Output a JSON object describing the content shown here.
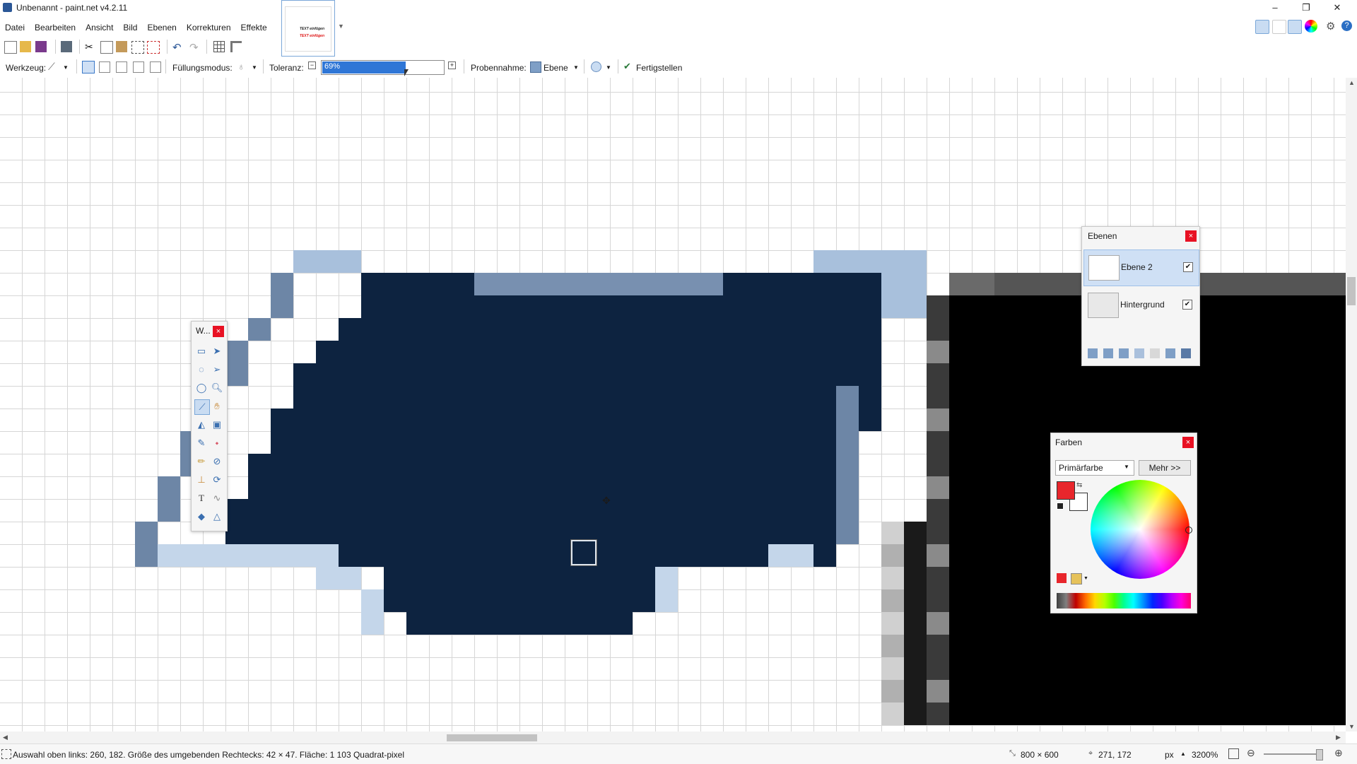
{
  "window": {
    "title": "Unbenannt - paint.net v4.2.11",
    "minimize": "–",
    "maximize": "❐",
    "close": "✕"
  },
  "menu": [
    "Datei",
    "Bearbeiten",
    "Ansicht",
    "Bild",
    "Ebenen",
    "Korrekturen",
    "Effekte"
  ],
  "document_thumbnail": {
    "line1": "TEXT einfügen",
    "line2": "TEXT einfügen"
  },
  "toolbar2": {
    "tool_label": "Werkzeug:",
    "fill_mode_label": "Füllungsmodus:",
    "tolerance_label": "Toleranz:",
    "tolerance_value": "69%",
    "tolerance_fraction": 0.69,
    "sampling_label": "Probennahme:",
    "sampling_value": "Ebene",
    "finish_label": "Fertigstellen"
  },
  "tools_panel": {
    "title": "W..."
  },
  "layers_panel": {
    "title": "Ebenen",
    "layers": [
      {
        "name": "Ebene 2",
        "visible": true,
        "selected": true
      },
      {
        "name": "Hintergrund",
        "visible": true,
        "selected": false
      }
    ]
  },
  "colors_panel": {
    "title": "Farben",
    "dropdown_value": "Primärfarbe",
    "more_button": "Mehr >>",
    "primary_color": "#e8262c",
    "secondary_color": "#ffffff"
  },
  "status": {
    "selection_info": "Auswahl oben links: 260, 182. Größe des umgebenden Rechtecks: 42 × 47. Fläche: 1 103 Quadrat-pixel",
    "image_size": "800 × 600",
    "cursor_position": "271, 172",
    "unit": "px",
    "zoom": "3200%"
  },
  "colors": {
    "selection_dark": "#0d2340",
    "accent": "#2f76d6"
  }
}
